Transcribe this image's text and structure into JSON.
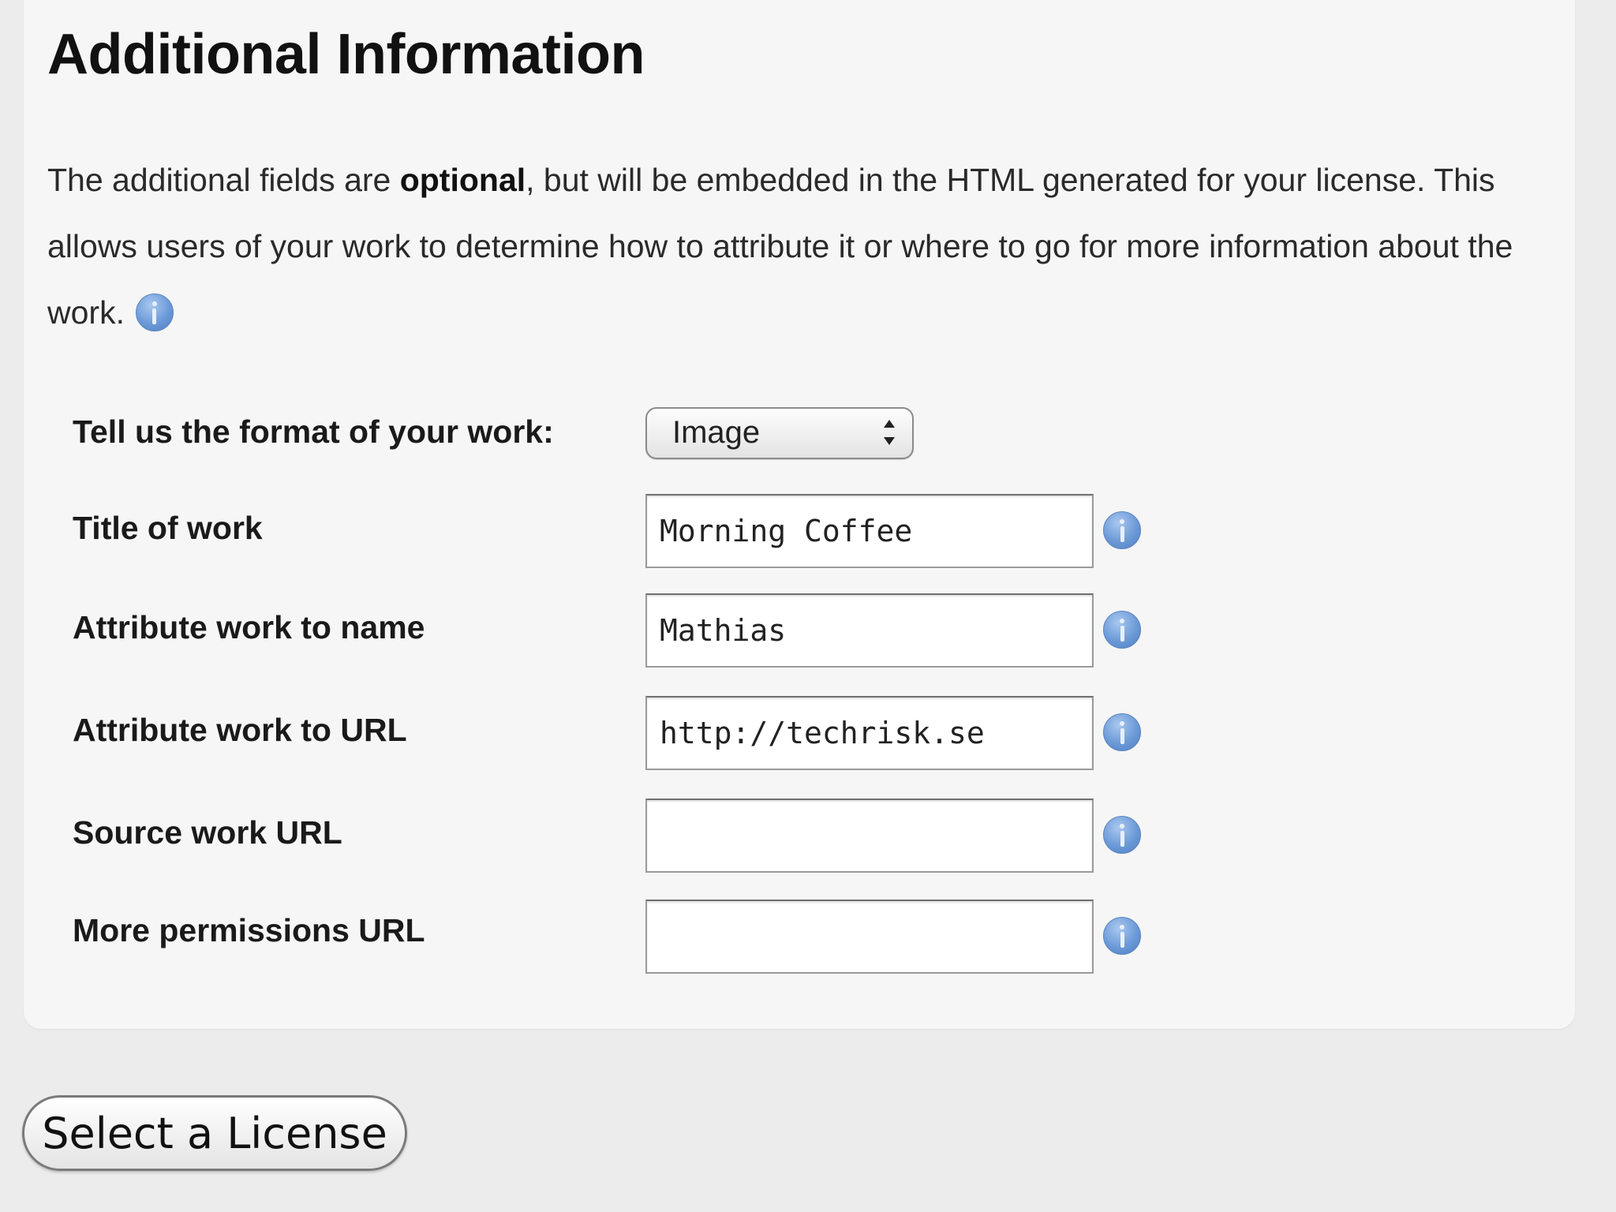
{
  "section": {
    "title": "Additional Information",
    "intro_before": "The additional fields are ",
    "intro_bold": "optional",
    "intro_after": ", but will be embedded in the HTML generated for your license. This allows users of your work to determine how to attribute it or where to go for more information about the work."
  },
  "form": {
    "format": {
      "label": "Tell us the format of your work:",
      "selected": "Image"
    },
    "title_of_work": {
      "label": "Title of work",
      "value": "Morning Coffee"
    },
    "attribute_name": {
      "label": "Attribute work to name",
      "value": "Mathias"
    },
    "attribute_url": {
      "label": "Attribute work to URL",
      "value": "http://techrisk.se"
    },
    "source_url": {
      "label": "Source work URL",
      "value": ""
    },
    "permissions_url": {
      "label": "More permissions URL",
      "value": ""
    }
  },
  "actions": {
    "select_license_label": "Select a License"
  },
  "icons": {
    "help": "info-icon",
    "select_arrows": "up-down-arrows-icon"
  },
  "colors": {
    "info_icon": "#6c9ad8",
    "panel_bg": "#f6f6f6",
    "page_bg": "#ececec"
  }
}
